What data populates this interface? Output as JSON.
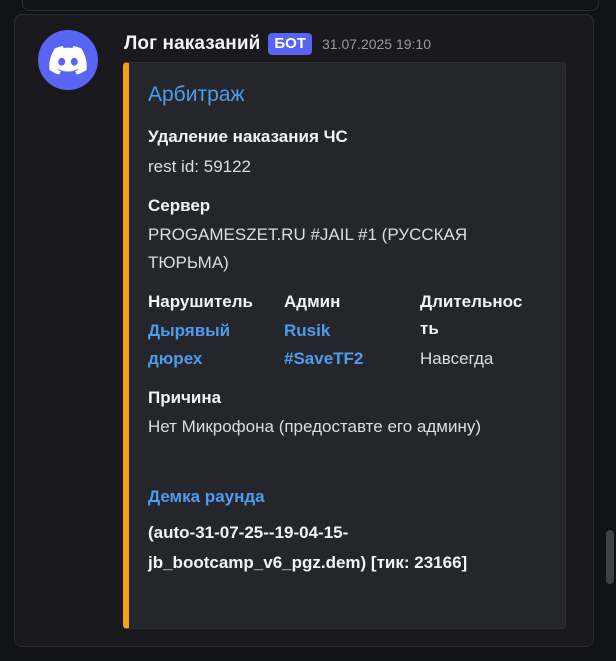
{
  "message": {
    "author": "Лог наказаний",
    "bot_tag": "БОТ",
    "timestamp": "31.07.2025 19:10",
    "avatar_icon": "discord-logo-icon"
  },
  "embed": {
    "accent_color": "#f2a31b",
    "title": "Арбитраж",
    "fields": {
      "removal": {
        "name": "Удаление наказания ЧС",
        "value": "rest id: 59122"
      },
      "server": {
        "name": "Сервер",
        "value_line1": "PROGAMESZET.RU #JAIL #1 (РУССКАЯ",
        "value_line2": "ТЮРЬМА)"
      },
      "violator": {
        "name": "Нарушитель",
        "value_line1": "Дырявый",
        "value_line2": "дюрех"
      },
      "admin": {
        "name": "Админ",
        "value_line1": "Rusik",
        "value_line2": "#SaveTF2"
      },
      "duration": {
        "name_line1": "Длительнос",
        "name_line2": "ть",
        "value": "Навсегда"
      },
      "reason": {
        "name": "Причина",
        "value": "Нет Микрофона (предоставте его админу)"
      }
    },
    "demo": {
      "link_label": "Демка раунда",
      "file_line1": "(auto-31-07-25--19-04-15-",
      "file_line2": "jb_bootcamp_v6_pgz.dem) [тик: 23166]"
    }
  }
}
